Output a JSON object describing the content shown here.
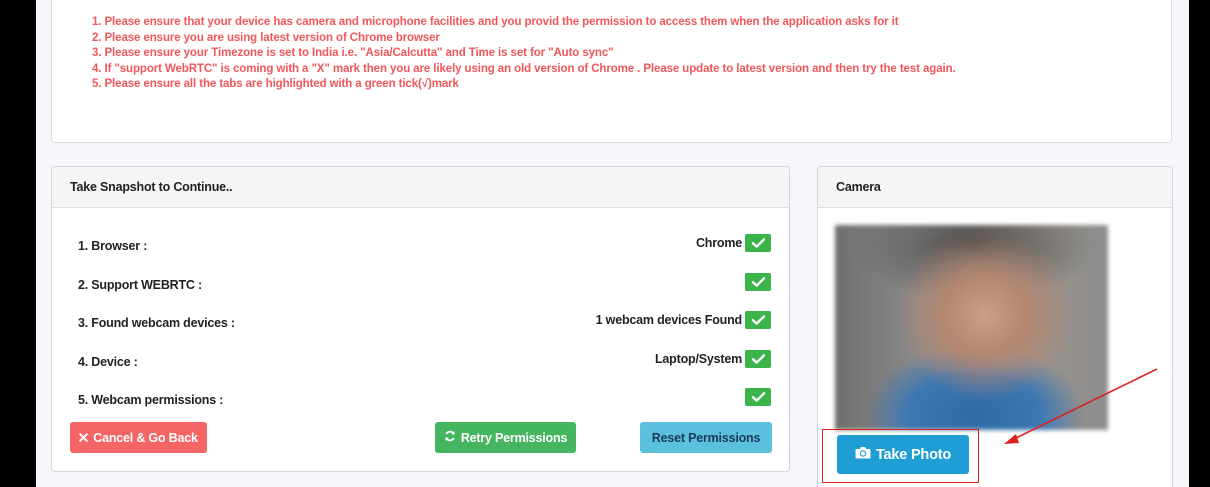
{
  "instructions": [
    "1. Please ensure that your device has camera and microphone facilities and you provid the permission to access them when the application asks for it",
    "2. Please ensure you are using latest version of Chrome browser",
    "3. Please ensure your Timezone is set to India i.e. \"Asia/Calcutta\" and Time is set for \"Auto sync\"",
    "4. If \"support WebRTC\" is coming with a \"X\" mark then you are likely using an old version of Chrome . Please update to latest version and then try the test again.",
    "5. Please ensure all the tabs are highlighted with a green tick(√)mark"
  ],
  "snapshot": {
    "title": "Take Snapshot to Continue..",
    "checks": [
      {
        "label": "1. Browser :",
        "value": "Chrome",
        "status": "ok"
      },
      {
        "label": "2. Support WEBRTC :",
        "value": "",
        "status": "ok"
      },
      {
        "label": "3. Found webcam devices :",
        "value": "1 webcam devices Found",
        "status": "ok"
      },
      {
        "label": "4. Device :",
        "value": "Laptop/System",
        "status": "ok"
      },
      {
        "label": "5. Webcam permissions :",
        "value": "",
        "status": "ok"
      }
    ],
    "cancel_label": "Cancel & Go Back",
    "retry_label": "Retry Permissions",
    "reset_label": "Reset Permissions"
  },
  "camera": {
    "title": "Camera",
    "take_photo_label": "Take Photo"
  },
  "colors": {
    "instruction_text": "#f0575b",
    "ok_badge": "#3bb44a",
    "cancel": "#f56565",
    "retry": "#45b560",
    "reset": "#5bc0de",
    "take_photo": "#1f9ed6",
    "annotation": "#e0201f"
  },
  "icons": {
    "check": "check-icon",
    "cancel": "times-icon",
    "retry": "refresh-icon",
    "camera": "camera-icon"
  }
}
